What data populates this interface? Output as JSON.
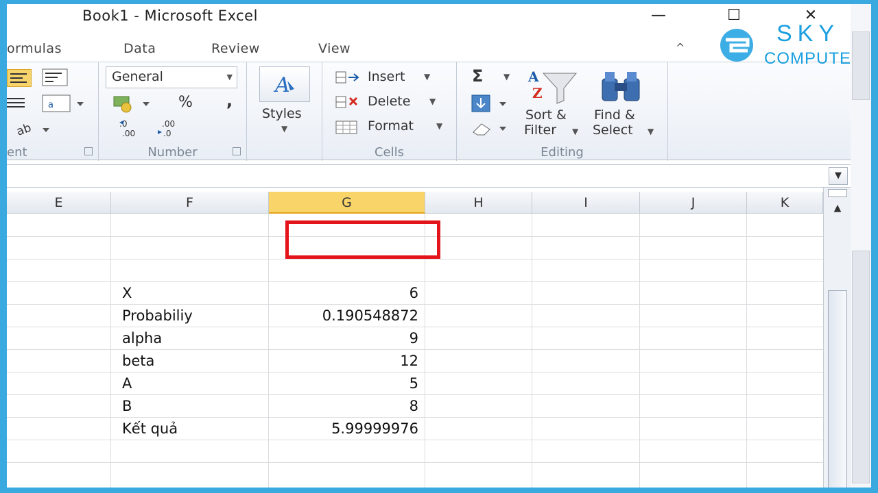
{
  "window": {
    "title": "Book1  -  Microsoft Excel",
    "minimize": "—",
    "maximize": "☐",
    "close": "✕"
  },
  "tabs": [
    {
      "label": "ormulas"
    },
    {
      "label": "Data"
    },
    {
      "label": "Review"
    },
    {
      "label": "View"
    }
  ],
  "logo": {
    "line1": "SKY",
    "line2": "COMPUTER"
  },
  "ribbon": {
    "alignment_group_label": "ent",
    "number": {
      "format_selected": "General",
      "percent": "%",
      "comma": ",",
      "inc_decimal": "←.0 .00",
      "dec_decimal": ".00 →.0",
      "group_label": "Number"
    },
    "styles": {
      "label": "Styles"
    },
    "cells": {
      "insert": "Insert",
      "delete": "Delete",
      "format": "Format",
      "group_label": "Cells"
    },
    "editing": {
      "sigma": "Σ",
      "sort_filter_1": "Sort &",
      "sort_filter_2": "Filter",
      "find_select_1": "Find &",
      "find_select_2": "Select",
      "group_label": "Editing"
    }
  },
  "sheet": {
    "columns": [
      "E",
      "F",
      "G",
      "H",
      "I",
      "J",
      "K"
    ],
    "selected_column": "G",
    "rows": [
      {
        "label": "X",
        "value": "6"
      },
      {
        "label": "Probabiliy",
        "value": "0.190548872"
      },
      {
        "label": "alpha",
        "value": "9"
      },
      {
        "label": "beta",
        "value": "12"
      },
      {
        "label": "A",
        "value": "5"
      },
      {
        "label": "B",
        "value": "8"
      },
      {
        "label": "Kết quả",
        "value": "5.99999976"
      }
    ]
  },
  "colors": {
    "frame_border": "#39a9e0",
    "selected_header": "#f8d469",
    "highlight_box": "#e3151a",
    "logo": "#1a9fe0"
  }
}
